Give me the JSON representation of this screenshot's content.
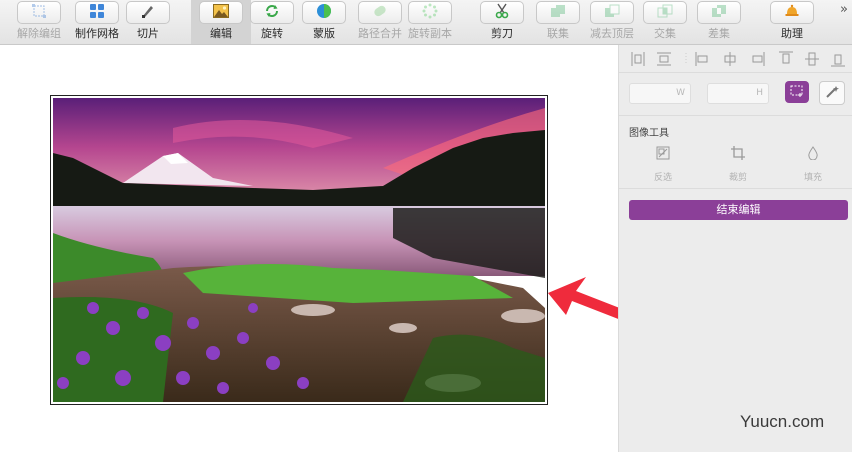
{
  "toolbar": {
    "items": [
      {
        "label": "解除编组",
        "icon": "ungroup-icon",
        "enabled": false
      },
      {
        "label": "制作网格",
        "icon": "grid-icon",
        "enabled": true
      },
      {
        "label": "切片",
        "icon": "slice-knife-icon",
        "enabled": true
      },
      {
        "label": "编辑",
        "icon": "image-edit-icon",
        "enabled": true,
        "active": true
      },
      {
        "label": "旋转",
        "icon": "rotate-icon",
        "enabled": true
      },
      {
        "label": "蒙版",
        "icon": "mask-icon",
        "enabled": true
      },
      {
        "label": "路径合并",
        "icon": "path-merge-icon",
        "enabled": false
      },
      {
        "label": "旋转副本",
        "icon": "rotate-copy-icon",
        "enabled": false
      },
      {
        "label": "剪刀",
        "icon": "scissors-icon",
        "enabled": true
      },
      {
        "label": "联集",
        "icon": "union-icon",
        "enabled": false
      },
      {
        "label": "减去顶层",
        "icon": "subtract-icon",
        "enabled": false
      },
      {
        "label": "交集",
        "icon": "intersect-icon",
        "enabled": false
      },
      {
        "label": "差集",
        "icon": "difference-icon",
        "enabled": false
      },
      {
        "label": "助理",
        "icon": "assistant-bell-icon",
        "enabled": true
      }
    ],
    "overflow_label": "»"
  },
  "inspector": {
    "width_field": {
      "value": "",
      "suffix": "W"
    },
    "height_field": {
      "value": "",
      "suffix": "H"
    },
    "image_tools": {
      "title": "图像工具",
      "tools": [
        {
          "label": "反选",
          "icon": "invert-selection-icon"
        },
        {
          "label": "裁剪",
          "icon": "crop-icon"
        },
        {
          "label": "填充",
          "icon": "fill-drop-icon"
        }
      ]
    },
    "finish_button_label": "结束编辑"
  },
  "canvas": {
    "image_description_icon": "landscape-photo",
    "annotation": "red-arrow-icon"
  },
  "watermark": "Yuucn.com",
  "colors": {
    "accent": "#8b3f98",
    "arrow": "#ef2b3c"
  }
}
